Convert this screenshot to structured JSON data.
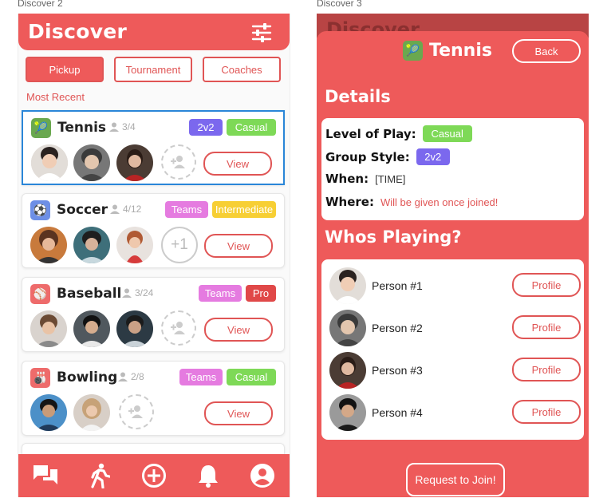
{
  "frames": {
    "left_label": "Discover 2",
    "right_label": "Discover 3"
  },
  "colors": {
    "accent": "#ee5a5a",
    "purple": "#7b68ee",
    "green": "#7ed957",
    "pink": "#e57be0",
    "yellow": "#f7cf34",
    "red_badge": "#e04848",
    "selected_border": "#2a86d8"
  },
  "discover": {
    "title": "Discover",
    "filter_icon": "tune-icon",
    "tabs": [
      "Pickup",
      "Tournament",
      "Coaches"
    ],
    "section": "Most Recent",
    "cards": [
      {
        "sport": "Tennis",
        "icon": "🎾",
        "icon_bg": "#6aa84f",
        "count": "3/4",
        "badges": [
          "2v2",
          "Casual"
        ],
        "view": "View"
      },
      {
        "sport": "Soccer",
        "icon": "⚽",
        "icon_bg": "#6d8fe6",
        "count": "4/12",
        "badges": [
          "Teams",
          "Intermediate"
        ],
        "extra": "+1",
        "view": "View"
      },
      {
        "sport": "Baseball",
        "icon": "⚾",
        "icon_bg": "#ee6b6b",
        "count": "3/24",
        "badges": [
          "Teams",
          "Pro"
        ],
        "view": "View"
      },
      {
        "sport": "Bowling",
        "icon": "🎳",
        "icon_bg": "#ee6b6b",
        "count": "2/8",
        "badges": [
          "Teams",
          "Casual"
        ],
        "view": "View"
      }
    ],
    "nav": [
      "chat-icon",
      "walk-icon",
      "add-circle-icon",
      "bell-icon",
      "account-icon"
    ]
  },
  "detail": {
    "bg_title": "Discover",
    "title": "Tennis",
    "icon": "🎾",
    "back": "Back",
    "details_heading": "Details",
    "level_label": "Level of Play:",
    "level_value": "Casual",
    "style_label": "Group Style:",
    "style_value": "2v2",
    "when_label": "When:",
    "when_value": "[TIME]",
    "where_label": "Where:",
    "where_value": "Will be given once joined!",
    "players_heading": "Whos Playing?",
    "players": [
      {
        "name": "Person #1",
        "button": "Profile"
      },
      {
        "name": "Person #2",
        "button": "Profile"
      },
      {
        "name": "Person #3",
        "button": "Profile"
      },
      {
        "name": "Person #4",
        "button": "Profile"
      }
    ],
    "join": "Request to Join!"
  }
}
